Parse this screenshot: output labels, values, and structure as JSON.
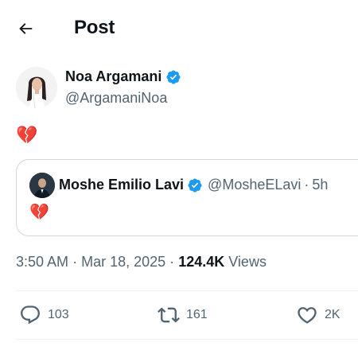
{
  "header": {
    "title": "Post"
  },
  "author": {
    "name": "Noa Argamani",
    "handle": "@ArgamaniNoa",
    "verified_color": "#1d9bf0"
  },
  "post": {
    "text": "💔"
  },
  "quote": {
    "name": "Moshe Emilio Lavi",
    "handle": "@MosheELavi",
    "separator": "·",
    "time": "5h",
    "text": "💔"
  },
  "meta": {
    "time": "3:50 AM",
    "sep1": "·",
    "date": "Mar 18, 2025",
    "sep2": "·",
    "views_count": "124.4K",
    "views_label": "Views"
  },
  "actions": {
    "replies": "103",
    "reposts": "161",
    "likes": "2K"
  },
  "icons": {
    "back": "arrow-left-icon",
    "verified": "verified-badge-icon",
    "reply": "reply-icon",
    "repost": "repost-icon",
    "like": "heart-icon"
  }
}
